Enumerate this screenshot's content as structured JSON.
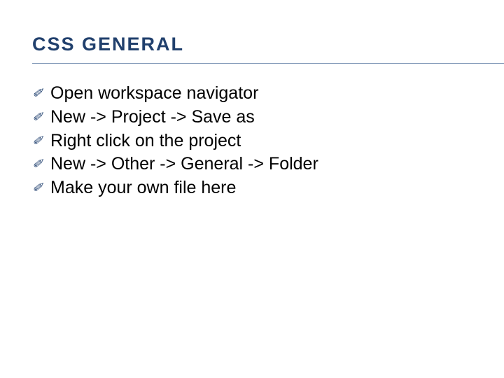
{
  "slide": {
    "title": "CSS GENERAL",
    "bullet_glyph": "✐",
    "items": [
      "Open workspace navigator",
      "New -> Project -> Save as",
      "Right click on the project",
      "New -> Other -> General -> Folder",
      "Make your own file here"
    ]
  }
}
